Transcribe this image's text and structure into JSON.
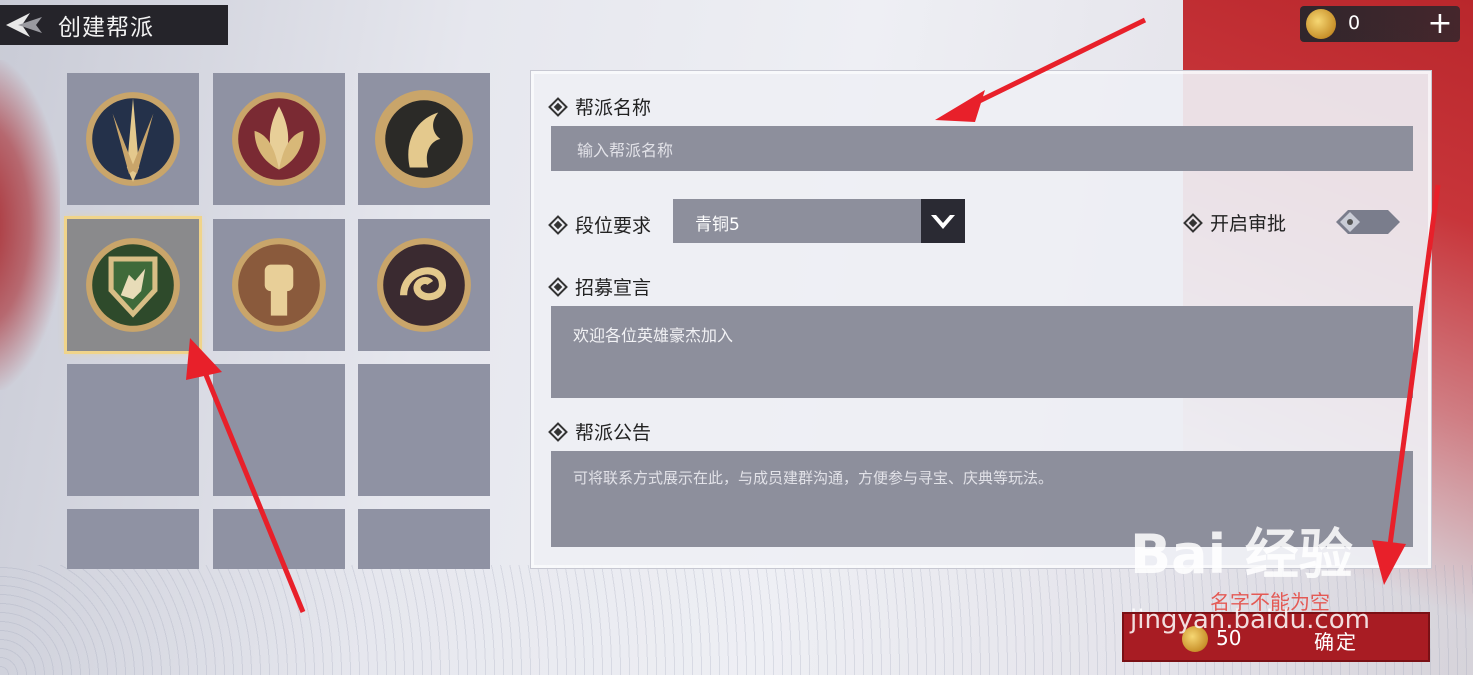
{
  "header": {
    "title": "创建帮派"
  },
  "currency": {
    "value": "0",
    "plus_label": "+"
  },
  "form": {
    "name_label": "帮派名称",
    "name_placeholder": "输入帮派名称",
    "rank_label": "段位要求",
    "rank_value": "青铜5",
    "approval_label": "开启审批",
    "recruit_label": "招募宣言",
    "recruit_value": "欢迎各位英雄豪杰加入",
    "notice_label": "帮派公告",
    "notice_placeholder": "可将联系方式展示在此，与成员建群沟通，方便参与寻宝、庆典等玩法。"
  },
  "footer": {
    "warning": "名字不能为空",
    "cost": "50",
    "confirm_label": "确定"
  },
  "emblems": [
    {
      "name": "sword-emblem"
    },
    {
      "name": "lotus-emblem"
    },
    {
      "name": "phoenix-emblem"
    },
    {
      "name": "wolf-shield-emblem",
      "selected": true
    },
    {
      "name": "fist-emblem"
    },
    {
      "name": "dragon-emblem"
    }
  ],
  "watermark": {
    "text": "Bai 经验",
    "url": "jingyan.baidu.com"
  },
  "colors": {
    "accent": "#a81c23",
    "gold": "#f0d48a",
    "annotation_red": "#e8202a"
  }
}
